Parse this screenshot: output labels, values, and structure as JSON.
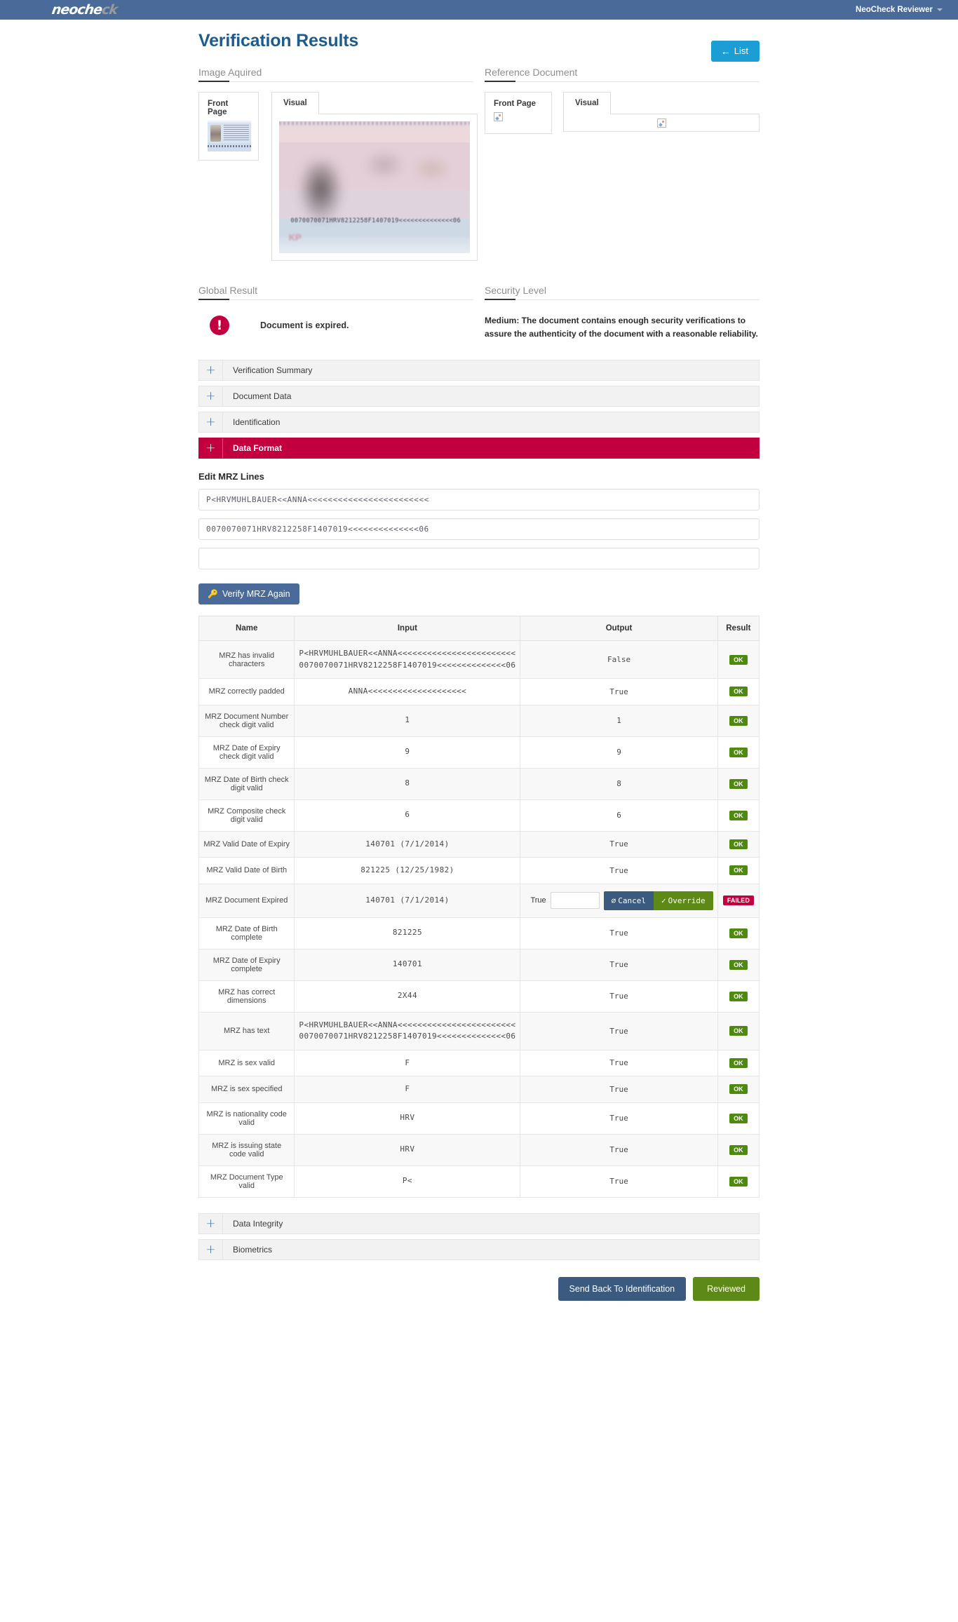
{
  "topbar": {
    "logo_main": "neoche",
    "logo_tail": "ck",
    "user_label": "NeoCheck Reviewer"
  },
  "header": {
    "title": "Verification Results",
    "list_button": "List",
    "list_arrow": "←"
  },
  "sections": {
    "image_acquired": "Image Aquired",
    "reference_document": "Reference Document",
    "global_result": "Global Result",
    "security_level": "Security Level"
  },
  "image_acquired": {
    "front_page_label": "Front Page",
    "visual_tab": "Visual",
    "doc_mrz_text": "0070070071HRV8212258F1407019<<<<<<<<<<<<<<06",
    "stamp": "KP"
  },
  "reference_document": {
    "front_page_label": "Front Page",
    "visual_tab": "Visual",
    "front_image_icon": "broken-image-icon",
    "visual_image_icon": "broken-image-icon"
  },
  "global_result": {
    "icon": "error-exclamation-icon",
    "message": "Document is expired."
  },
  "security_level": {
    "text": "Medium: The document contains enough security verifications to assure the authenticity of the document with a reasonable reliability."
  },
  "accordions": [
    {
      "label": "Verification Summary",
      "state": "collapsed",
      "style": "default"
    },
    {
      "label": "Document Data",
      "state": "collapsed",
      "style": "default"
    },
    {
      "label": "Identification",
      "state": "collapsed",
      "style": "default"
    },
    {
      "label": "Data Format",
      "state": "expanded",
      "style": "danger"
    }
  ],
  "accordions_bottom": [
    {
      "label": "Data Integrity",
      "state": "collapsed",
      "style": "default"
    },
    {
      "label": "Biometrics",
      "state": "collapsed",
      "style": "default"
    }
  ],
  "mrz_edit": {
    "heading": "Edit MRZ Lines",
    "line1": "P<HRVMUHLBAUER<<ANNA<<<<<<<<<<<<<<<<<<<<<<<<",
    "line2": "0070070071HRV8212258F1407019<<<<<<<<<<<<<<06",
    "line3": "",
    "line1_placeholder": "",
    "line2_placeholder": "",
    "line3_placeholder": "",
    "verify_button": "Verify MRZ Again",
    "verify_icon": "key-icon"
  },
  "table": {
    "columns": [
      "Name",
      "Input",
      "Output",
      "Result"
    ],
    "rows": [
      {
        "name": "MRZ has invalid characters",
        "input": "P<HRVMUHLBAUER<<ANNA<<<<<<<<<<<<<<<<<<<<<<<<\n0070070071HRV8212258F1407019<<<<<<<<<<<<<<06",
        "output": "False",
        "result": "OK",
        "result_state": "ok"
      },
      {
        "name": "MRZ correctly padded",
        "input": "ANNA<<<<<<<<<<<<<<<<<<<<",
        "output": "True",
        "result": "OK",
        "result_state": "ok"
      },
      {
        "name": "MRZ Document Number check digit valid",
        "input": "1",
        "output": "1",
        "result": "OK",
        "result_state": "ok"
      },
      {
        "name": "MRZ Date of Expiry check digit valid",
        "input": "9",
        "output": "9",
        "result": "OK",
        "result_state": "ok"
      },
      {
        "name": "MRZ Date of Birth check digit valid",
        "input": "8",
        "output": "8",
        "result": "OK",
        "result_state": "ok"
      },
      {
        "name": "MRZ Composite check digit valid",
        "input": "6",
        "output": "6",
        "result": "OK",
        "result_state": "ok"
      },
      {
        "name": "MRZ Valid Date of Expiry",
        "input": "140701 (7/1/2014)",
        "output": "True",
        "result": "OK",
        "result_state": "ok"
      },
      {
        "name": "MRZ Valid Date of Birth",
        "input": "821225 (12/25/1982)",
        "output": "True",
        "result": "OK",
        "result_state": "ok"
      },
      {
        "name": "MRZ Document Expired",
        "input": "140701 (7/1/2014)",
        "output": "True",
        "result": "FAILED",
        "result_state": "failed",
        "override": {
          "value_label": "True",
          "field_value": "",
          "cancel_label": "Cancel",
          "cancel_icon": "ban-icon",
          "override_label": "Override",
          "override_icon": "check-icon"
        }
      },
      {
        "name": "MRZ Date of Birth complete",
        "input": "821225",
        "output": "True",
        "result": "OK",
        "result_state": "ok"
      },
      {
        "name": "MRZ Date of Expiry complete",
        "input": "140701",
        "output": "True",
        "result": "OK",
        "result_state": "ok"
      },
      {
        "name": "MRZ has correct dimensions",
        "input": "2X44",
        "output": "True",
        "result": "OK",
        "result_state": "ok"
      },
      {
        "name": "MRZ has text",
        "input": "P<HRVMUHLBAUER<<ANNA<<<<<<<<<<<<<<<<<<<<<<<<\n0070070071HRV8212258F1407019<<<<<<<<<<<<<<06",
        "output": "True",
        "result": "OK",
        "result_state": "ok"
      },
      {
        "name": "MRZ is sex valid",
        "input": "F",
        "output": "True",
        "result": "OK",
        "result_state": "ok"
      },
      {
        "name": "MRZ is sex specified",
        "input": "F",
        "output": "True",
        "result": "OK",
        "result_state": "ok"
      },
      {
        "name": "MRZ is nationality code valid",
        "input": "HRV",
        "output": "True",
        "result": "OK",
        "result_state": "ok"
      },
      {
        "name": "MRZ is issuing state code valid",
        "input": "HRV",
        "output": "True",
        "result": "OK",
        "result_state": "ok"
      },
      {
        "name": "MRZ Document Type valid",
        "input": "P<",
        "output": "True",
        "result": "OK",
        "result_state": "ok"
      }
    ]
  },
  "footer": {
    "send_back": "Send Back To Identification",
    "reviewed": "Reviewed"
  },
  "colors": {
    "brand_blue": "#4a6a99",
    "title_blue": "#1d5c8f",
    "list_blue": "#1a9ed4",
    "danger": "#c2003f",
    "ok_green": "#4f8a10",
    "override_green": "#5d8a16"
  }
}
